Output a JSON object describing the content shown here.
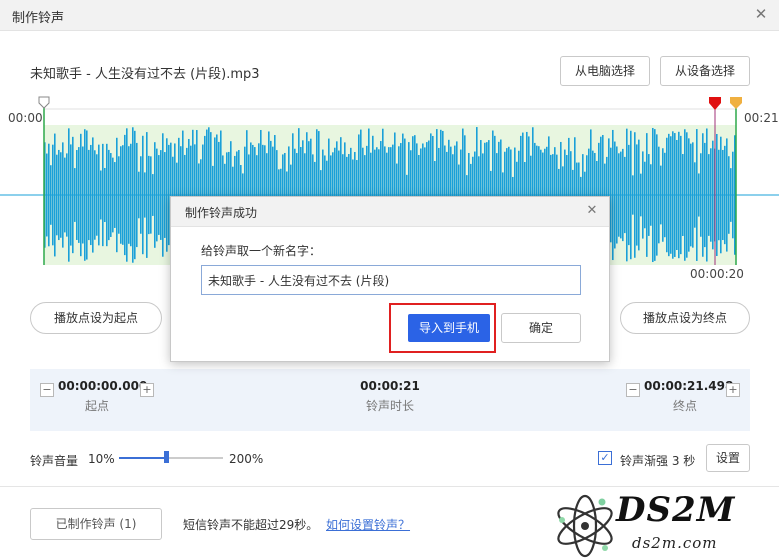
{
  "window": {
    "title": "制作铃声"
  },
  "file": {
    "name": "未知歌手 - 人生没有过不去 (片段).mp3",
    "btn_from_pc": "从电脑选择",
    "btn_from_device": "从设备选择"
  },
  "waveform": {
    "start_time": "00:00",
    "end_time": "00:21",
    "selection_end_time": "00:00:20"
  },
  "actions": {
    "set_start": "播放点设为起点",
    "set_end": "播放点设为终点"
  },
  "info": {
    "start_value": "00:00:00.000",
    "start_label": "起点",
    "duration_value": "00:00:21",
    "duration_label": "铃声时长",
    "end_value": "00:00:21.498",
    "end_label": "终点"
  },
  "volume": {
    "label": "铃声音量",
    "min": "10%",
    "max": "200%",
    "level_fraction": 0.45
  },
  "fade": {
    "checked": true,
    "label": "铃声渐强 3 秒",
    "settings": "设置"
  },
  "footer": {
    "made_button": "已制作铃声 (1)",
    "sms_note": "短信铃声不能超过29秒。",
    "help_link": "如何设置铃声？"
  },
  "watermark": {
    "big": "DS2M",
    "small": "ds2m.com"
  },
  "dialog": {
    "title": "制作铃声成功",
    "prompt": "给铃声取一个新名字：",
    "name_value": "未知歌手 - 人生没有过不去 (片段)",
    "import_button": "导入到手机",
    "ok_button": "确定"
  },
  "colors": {
    "wave": "#1aa0d8",
    "selection_bg": "#e8f6e0",
    "accent": "#2b63e6",
    "highlight": "#e02020",
    "start_marker": "#ffffff",
    "end_marker": "#e01010",
    "end_marker2": "#f0b040"
  }
}
